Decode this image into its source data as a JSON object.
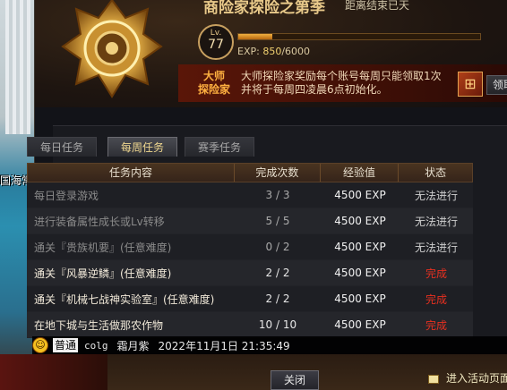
{
  "background": {
    "side_text": "国海常饰"
  },
  "header": {
    "title": "商险家探险之第季",
    "subtitle": "距离结束已天",
    "level_prefix": "Lv.",
    "level": "77",
    "exp_label": "EXP:",
    "exp_current": "850",
    "exp_max": "/6000",
    "exp_fraction": 0.1417,
    "rank_title_line1": "大师",
    "rank_title_line2": "探险家",
    "notice_line1": "大师探险家奖励每个账号每周只能领取1次",
    "notice_line2": "并将于每周四凌晨6点初始化。",
    "claim_label": "领取"
  },
  "tabs": [
    {
      "label": "每日任务",
      "active": false
    },
    {
      "label": "每周任务",
      "active": true
    },
    {
      "label": "赛季任务",
      "active": false
    }
  ],
  "table": {
    "headers": [
      "任务内容",
      "完成次数",
      "经验值",
      "状态"
    ],
    "rows": [
      {
        "task": "每日登录游戏",
        "count": "3 / 3",
        "exp": "4500 EXP",
        "status": "无法进行",
        "style": "dim"
      },
      {
        "task": "进行装备属性成长或Lv转移",
        "count": "5 / 5",
        "exp": "4500 EXP",
        "status": "无法进行",
        "style": "dim"
      },
      {
        "task": "通关『贵族机要』(任意难度)",
        "count": "0 / 2",
        "exp": "4500 EXP",
        "status": "无法进行",
        "style": "dim"
      },
      {
        "task": "通关『风暴逆鳞』(任意难度)",
        "count": "2 / 2",
        "exp": "4500 EXP",
        "status": "完成",
        "style": "bright"
      },
      {
        "task": "通关『机械七战神实验室』(任意难度)",
        "count": "2 / 2",
        "exp": "4500 EXP",
        "status": "完成",
        "style": "bright"
      },
      {
        "task": "在地下城与生活做那农作物",
        "count": "10 / 10",
        "exp": "4500 EXP",
        "status": "完成",
        "style": "bright"
      }
    ]
  },
  "chat": {
    "channel": "普通",
    "name": "colg",
    "message": "霜月紫",
    "time": "2022年11月1日 21:35:49"
  },
  "footer": {
    "close_label": "关闭",
    "event_label": "进入活动页面"
  }
}
